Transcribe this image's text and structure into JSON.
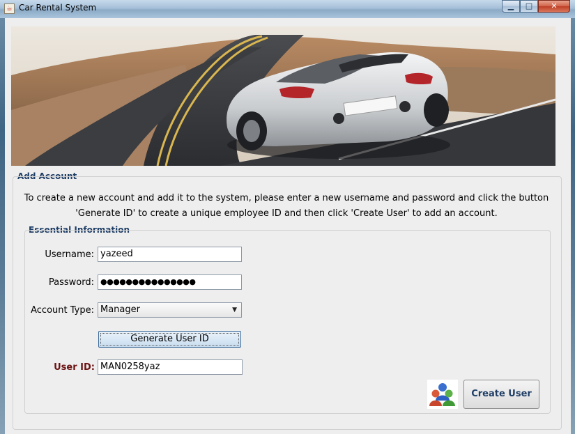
{
  "window": {
    "title": "Car Rental System",
    "controls": {
      "minimize": "▁",
      "maximize": "□",
      "close": "✕"
    }
  },
  "banner": {
    "description": ""
  },
  "add_account": {
    "title": "Add Account",
    "description_line1": "To create a new account and add it to the system, please enter a new username and password and click the button",
    "description_line2": "'Generate ID' to create a unique employee ID and then click 'Create User' to add an account."
  },
  "essential_info": {
    "title": "Essential Information",
    "username_label": "Username:",
    "username_value": "yazeed",
    "password_label": "Password:",
    "password_value": "●●●●●●●●●●●●●●●",
    "account_type_label": "Account Type:",
    "account_type_value": "Manager",
    "generate_button": "Generate User ID",
    "user_id_label": "User ID:",
    "user_id_value": "MAN0258yaz"
  },
  "actions": {
    "create_user_button": "Create User",
    "users_icon": "users-icon"
  }
}
